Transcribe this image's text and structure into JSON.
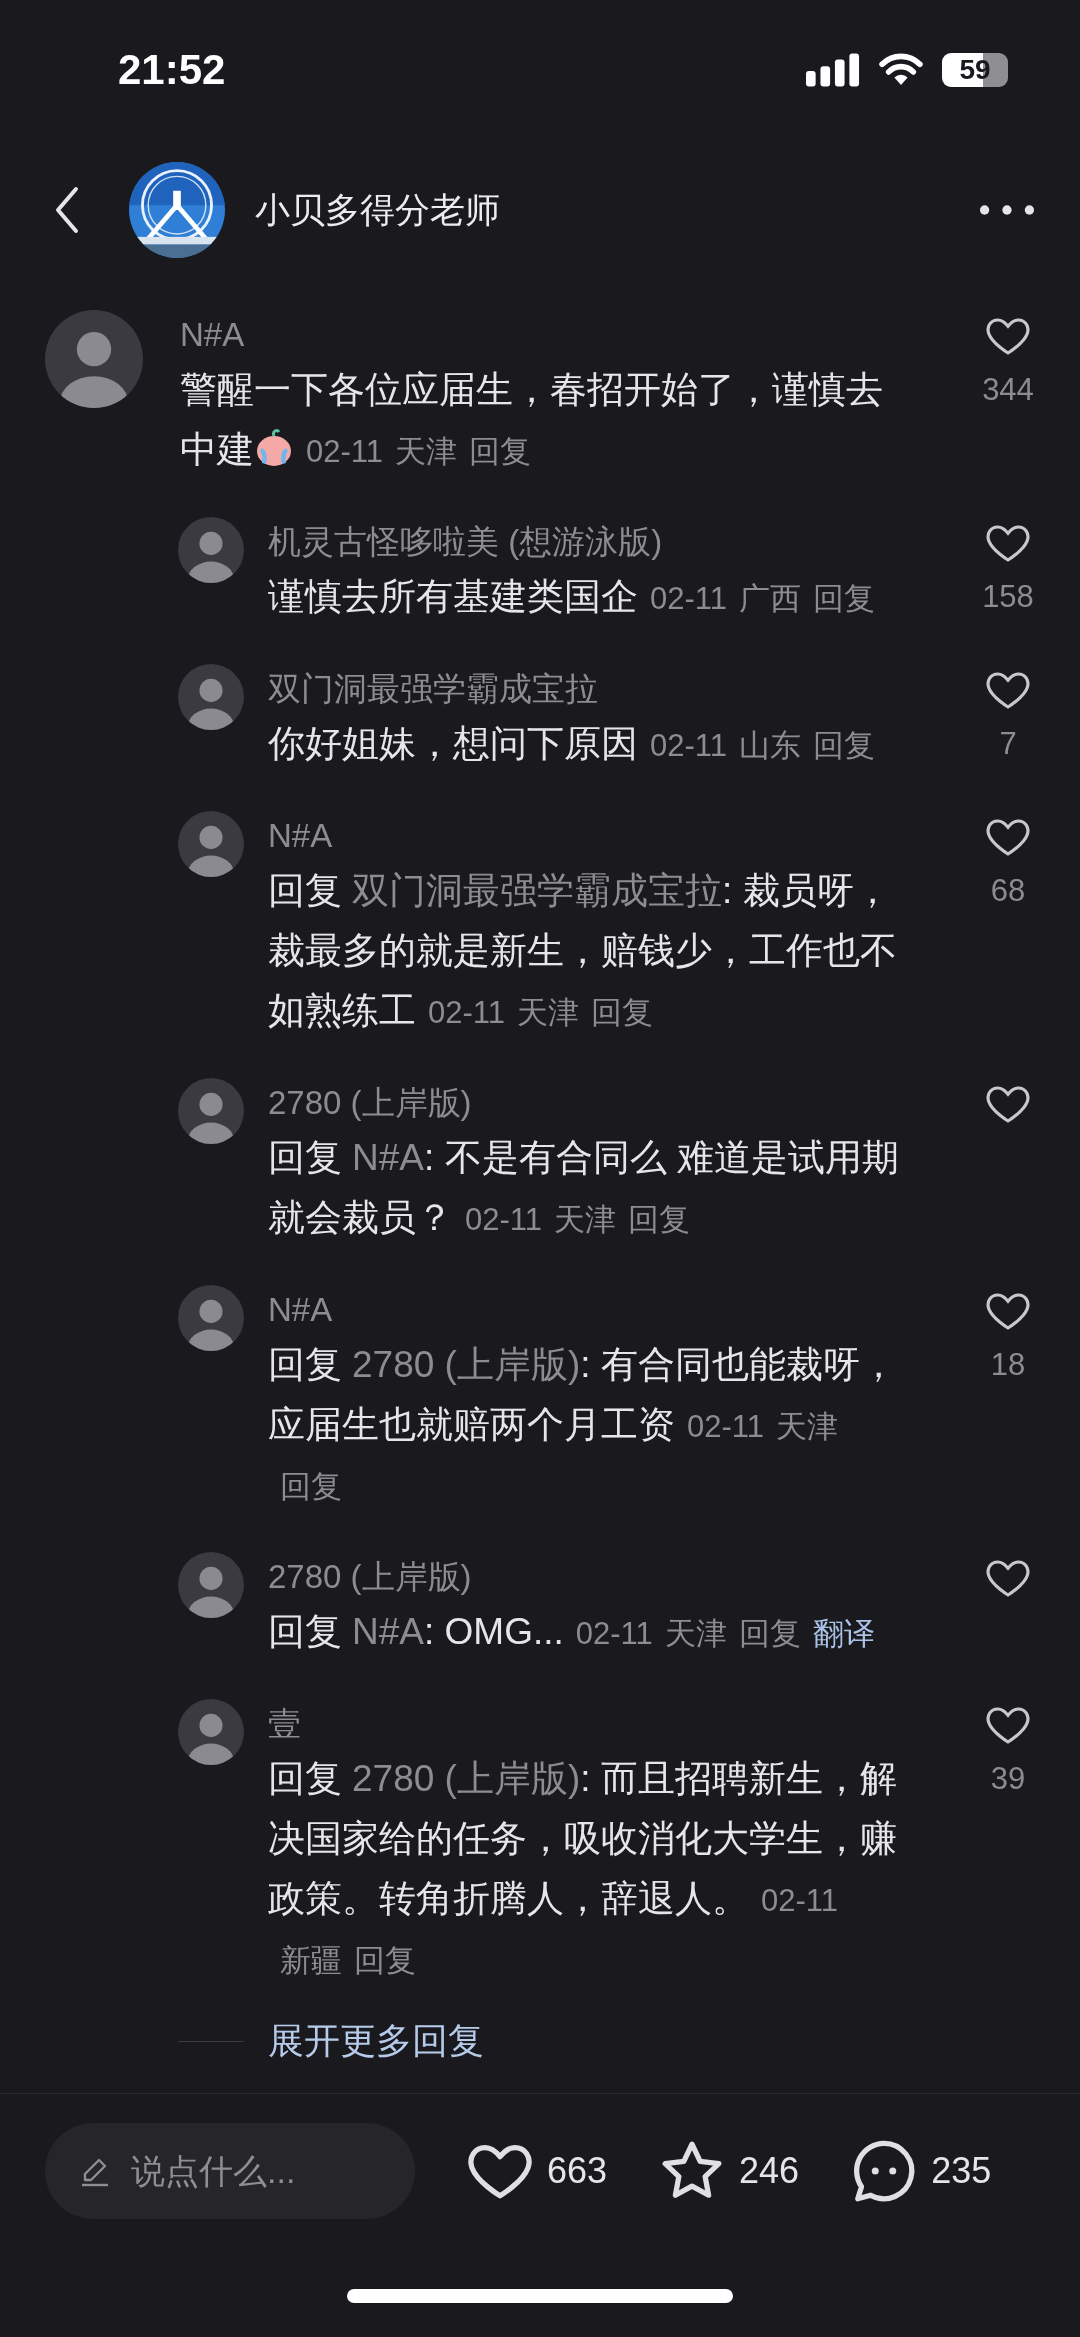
{
  "status_bar": {
    "time": "21:52",
    "battery": "59"
  },
  "header": {
    "title": "小贝多得分老师"
  },
  "comments": [
    {
      "author": "N#A",
      "text": "警醒一下各位应届生，春招开始了，谨慎去中建",
      "has_emoji": true,
      "date": "02-11",
      "location": "天津",
      "reply": "回复",
      "liked": false,
      "likes": "344",
      "replies": [
        {
          "author": "机灵古怪哆啦美 (想游泳版)",
          "text": "谨慎去所有基建类国企",
          "date": "02-11",
          "location": "广西",
          "reply": "回复",
          "liked": false,
          "likes": "158"
        },
        {
          "author": "双门洞最强学霸成宝拉",
          "text": "你好姐妹，想问下原因",
          "date": "02-11",
          "location": "山东",
          "reply": "回复",
          "liked": false,
          "likes": "7"
        },
        {
          "author": "N#A",
          "prefix": "回复",
          "reply_to": "双门洞最强学霸成宝拉",
          "text": ": 裁员呀，裁最多的就是新生，赔钱少，工作也不如熟练工",
          "date": "02-11",
          "location": "天津",
          "reply": "回复",
          "liked": false,
          "likes": "68"
        },
        {
          "author": "2780 (上岸版)",
          "prefix": "回复",
          "reply_to": "N#A",
          "text": ": 不是有合同么 难道是试用期就会裁员？",
          "date": "02-11",
          "location": "天津",
          "reply": "回复",
          "liked": false
        },
        {
          "author": "N#A",
          "prefix": "回复",
          "reply_to": "2780 (上岸版)",
          "text": ": 有合同也能裁呀，应届生也就赔两个月工资",
          "date": "02-11",
          "location": "天津",
          "reply": "回复",
          "liked": false,
          "likes": "18"
        },
        {
          "author": "2780 (上岸版)",
          "prefix": "回复",
          "reply_to": "N#A",
          "text": ": OMG...",
          "date": "02-11",
          "location": "天津",
          "reply": "回复",
          "translate": "翻译",
          "liked": false
        },
        {
          "author": "壹",
          "prefix": "回复",
          "reply_to": "2780 (上岸版)",
          "text": ": 而且招聘新生，解决国家给的任务，吸收消化大学生，赚政策。转角折腾人，辞退人。",
          "date": "02-11",
          "location": "新疆",
          "reply": "回复",
          "liked": false,
          "likes": "39"
        }
      ],
      "more_replies": "展开更多回复"
    }
  ],
  "bottom_bar": {
    "input": {
      "placeholder": "说点什么..."
    },
    "actions": [
      {
        "kind": "like",
        "count": "663"
      },
      {
        "kind": "star",
        "count": "246"
      },
      {
        "kind": "comment",
        "count": "235"
      }
    ]
  }
}
